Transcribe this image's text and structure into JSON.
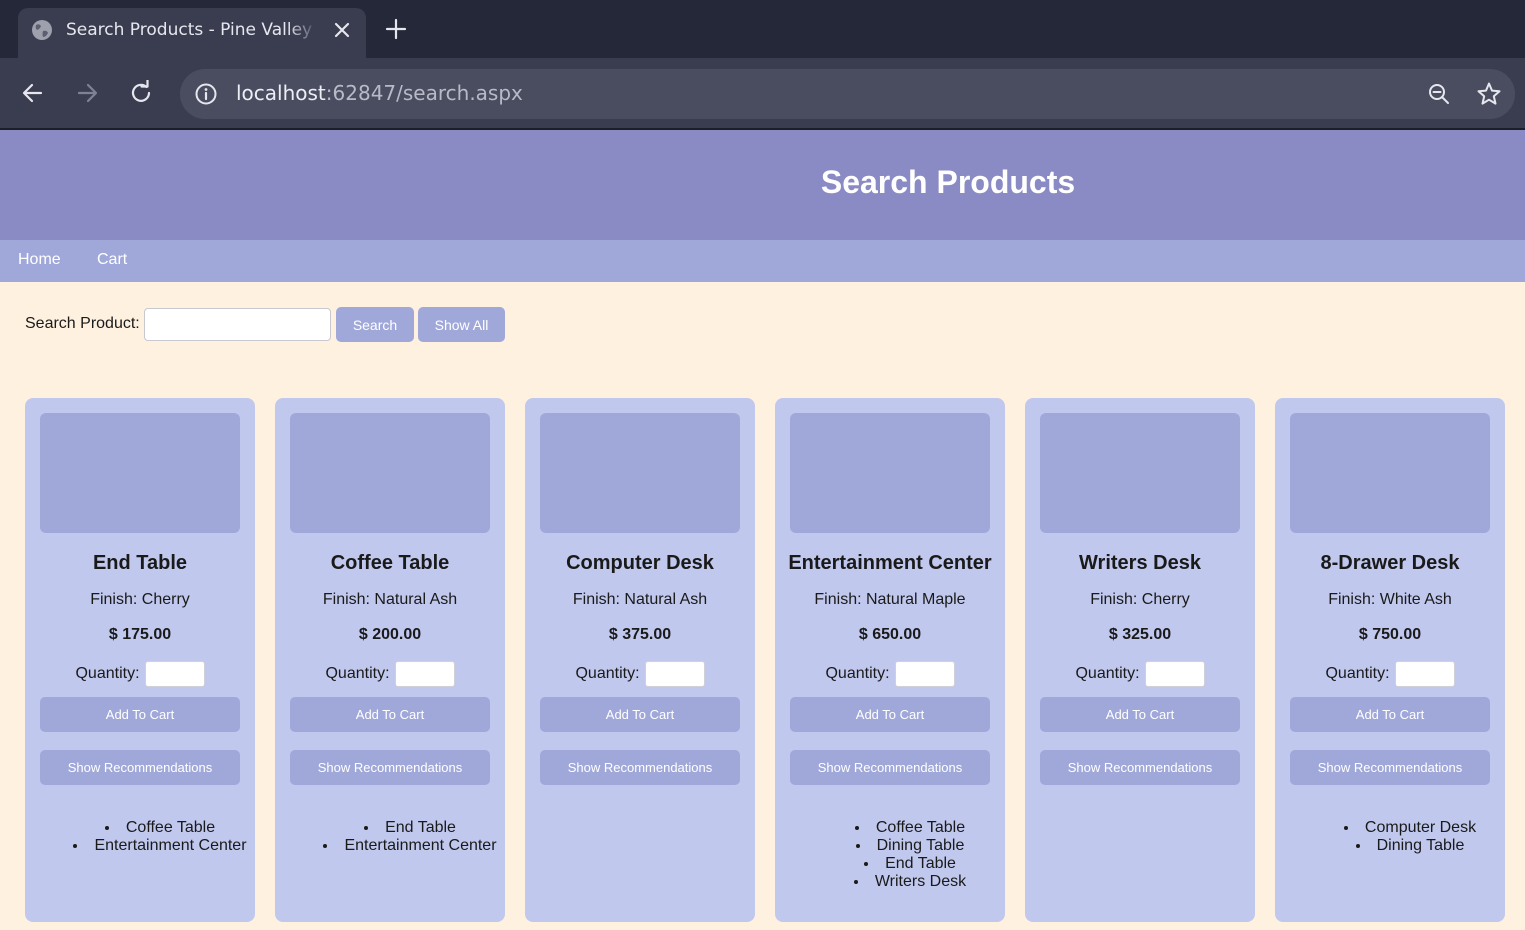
{
  "browser": {
    "tab_title": "Search Products - Pine Valley Furniture",
    "url_host": "localhost",
    "url_rest": ":62847/search.aspx"
  },
  "header": {
    "title": "Search Products"
  },
  "nav": {
    "home": "Home",
    "cart": "Cart"
  },
  "search": {
    "label": "Search Product:",
    "value": "",
    "search_button": "Search",
    "show_all_button": "Show All"
  },
  "labels": {
    "quantity": "Quantity:",
    "add_to_cart": "Add To Cart",
    "show_recommendations": "Show Recommendations"
  },
  "products": [
    {
      "name": "End Table",
      "finish": "Finish: Cherry",
      "price": "$ 175.00",
      "recommendations": [
        "Coffee Table",
        "Entertainment Center"
      ]
    },
    {
      "name": "Coffee Table",
      "finish": "Finish: Natural Ash",
      "price": "$ 200.00",
      "recommendations": [
        "End Table",
        "Entertainment Center"
      ]
    },
    {
      "name": "Computer Desk",
      "finish": "Finish: Natural Ash",
      "price": "$ 375.00",
      "recommendations": []
    },
    {
      "name": "Entertainment Center",
      "finish": "Finish: Natural Maple",
      "price": "$ 650.00",
      "recommendations": [
        "Coffee Table",
        "Dining Table",
        "End Table",
        "Writers Desk"
      ]
    },
    {
      "name": "Writers Desk",
      "finish": "Finish: Cherry",
      "price": "$ 325.00",
      "recommendations": []
    },
    {
      "name": "8-Drawer Desk",
      "finish": "Finish: White Ash",
      "price": "$ 750.00",
      "recommendations": [
        "Computer Desk",
        "Dining Table"
      ]
    }
  ],
  "colors": {
    "header_bg": "#8a8ac4",
    "nav_bg": "#a0a8da",
    "card_bg": "#c0c8ee",
    "page_bg": "#fff1e0"
  }
}
